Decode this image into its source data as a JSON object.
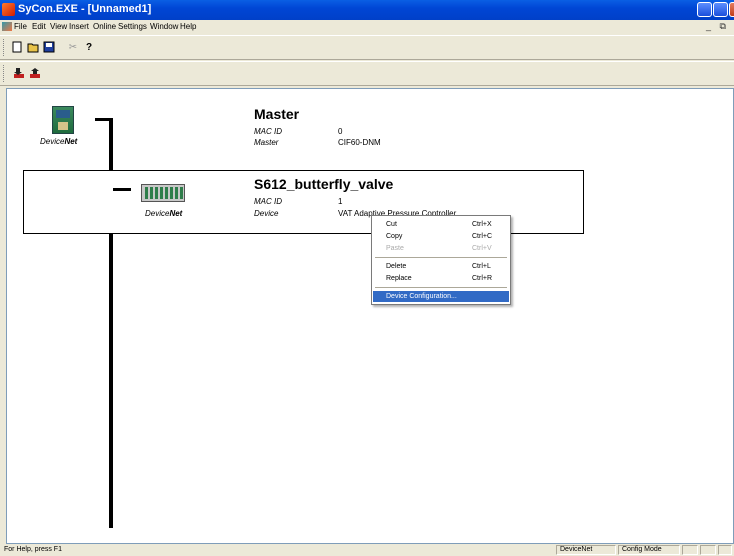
{
  "window": {
    "title": "SyCon.EXE - [Unnamed1]"
  },
  "menu": [
    "File",
    "Edit",
    "View",
    "Insert",
    "Online",
    "Settings",
    "Window",
    "Help"
  ],
  "toolbar1": [
    "new-icon",
    "open-icon",
    "save-icon",
    "cut-icon",
    "help-icon"
  ],
  "toolbar2": [
    "download-icon",
    "upload-icon"
  ],
  "mdi_controls": "_ ⧉",
  "network": {
    "master": {
      "name": "Master",
      "bus_label_prefix": "Device",
      "bus_label_suffix": "Net",
      "fields": [
        {
          "key": "MAC ID",
          "value": "0"
        },
        {
          "key": "Master",
          "value": "CIF60-DNM"
        }
      ]
    },
    "slave": {
      "name": "S612_butterfly_valve",
      "bus_label_prefix": "Device",
      "bus_label_suffix": "Net",
      "fields": [
        {
          "key": "MAC ID",
          "value": "1"
        },
        {
          "key": "Device",
          "value": "VAT Adaptive Pressure Controller"
        }
      ]
    }
  },
  "context_menu": {
    "items": [
      {
        "label": "Cut",
        "shortcut": "Ctrl+X"
      },
      {
        "label": "Copy",
        "shortcut": "Ctrl+C"
      },
      {
        "label": "Paste",
        "shortcut": "Ctrl+V"
      },
      {
        "label": "Delete",
        "shortcut": "Ctrl+L"
      },
      {
        "label": "Replace",
        "shortcut": "Ctrl+R"
      },
      {
        "label": "Device Configuration...",
        "shortcut": ""
      }
    ]
  },
  "statusbar": {
    "help_text": "For Help, press F1",
    "bus": "DeviceNet",
    "mode": "Config Mode"
  }
}
